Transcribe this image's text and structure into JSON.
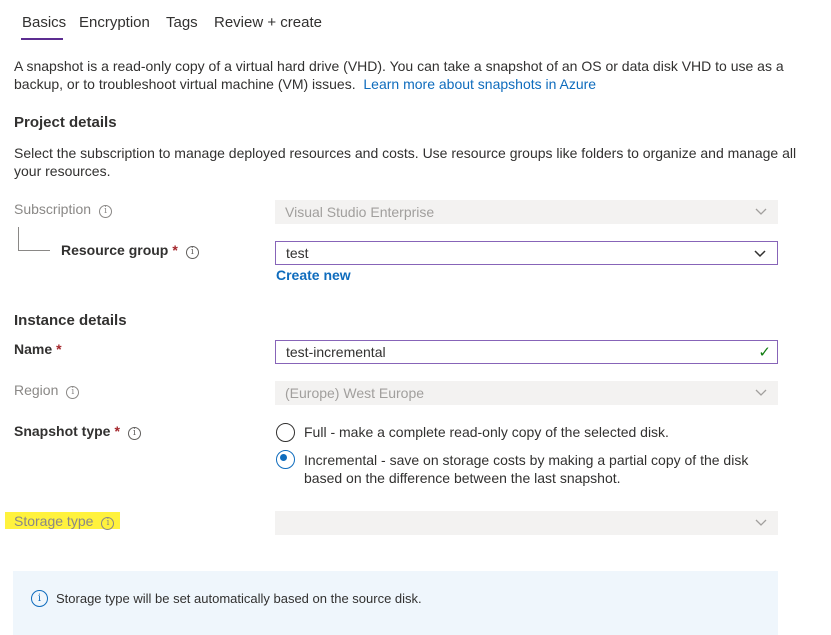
{
  "tabs": [
    {
      "label": "Basics"
    },
    {
      "label": "Encryption"
    },
    {
      "label": "Tags"
    },
    {
      "label": "Review + create"
    }
  ],
  "intro": {
    "text": "A snapshot is a read-only copy of a virtual hard drive (VHD). You can take a snapshot of an OS or data disk VHD to use as a backup, or to troubleshoot virtual machine (VM) issues.",
    "link": "Learn more about snapshots in Azure"
  },
  "project": {
    "title": "Project details",
    "description": "Select the subscription to manage deployed resources and costs. Use resource groups like folders to organize and manage all your resources.",
    "subscription_label": "Subscription",
    "subscription_value": "Visual Studio Enterprise",
    "resource_group_label": "Resource group",
    "resource_group_value": "test",
    "create_new": "Create new"
  },
  "instance": {
    "title": "Instance details",
    "name_label": "Name",
    "name_value": "test-incremental",
    "region_label": "Region",
    "region_value": "(Europe) West Europe",
    "snapshot_type_label": "Snapshot type",
    "option_full": "Full - make a complete read-only copy of the selected disk.",
    "option_incremental": "Incremental - save on storage costs by making a partial copy of the disk based on the difference between the last snapshot.",
    "selected_option": "Incremental",
    "storage_type_label": "Storage type",
    "storage_type_value": ""
  },
  "info_box": {
    "text": "Storage type will be set automatically based on the source disk."
  },
  "colors": {
    "accent": "#5c2d91",
    "link": "#0f6cbd",
    "highlight": "#fff23d",
    "required": "#a4262c",
    "valid": "#107c10"
  }
}
